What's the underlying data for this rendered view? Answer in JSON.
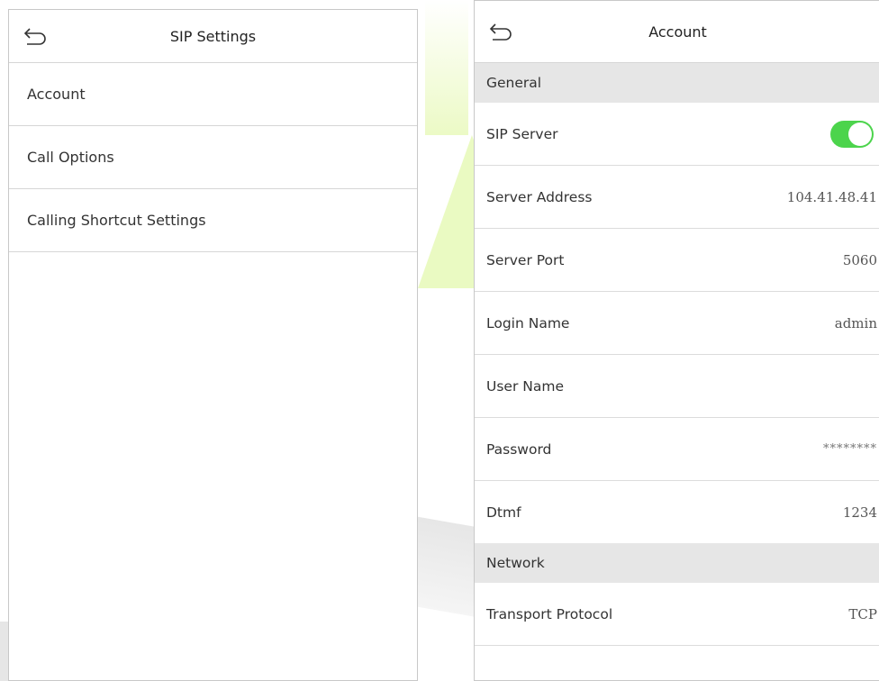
{
  "left_screen": {
    "title": "SIP Settings",
    "back_icon": "back-arrow-icon",
    "items": [
      {
        "label": "Account"
      },
      {
        "label": "Call Options"
      },
      {
        "label": "Calling Shortcut Settings"
      }
    ]
  },
  "right_screen": {
    "title": "Account",
    "back_icon": "back-arrow-icon",
    "sections": {
      "general": "General",
      "network": "Network"
    },
    "rows": {
      "sip_server": {
        "label": "SIP Server",
        "enabled": true
      },
      "server_address": {
        "label": "Server Address",
        "value": "104.41.48.41"
      },
      "server_port": {
        "label": "Server Port",
        "value": "5060"
      },
      "login_name": {
        "label": "Login Name",
        "value": "admin"
      },
      "user_name": {
        "label": "User Name",
        "value": ""
      },
      "password": {
        "label": "Password",
        "value": "********"
      },
      "dtmf": {
        "label": "Dtmf",
        "value": "1234"
      },
      "transport_protocol": {
        "label": "Transport Protocol",
        "value": "TCP"
      }
    }
  },
  "colors": {
    "toggle_on": "#4cd44c",
    "section_bg": "#e6e6e6",
    "divider": "#d6d6d6"
  }
}
